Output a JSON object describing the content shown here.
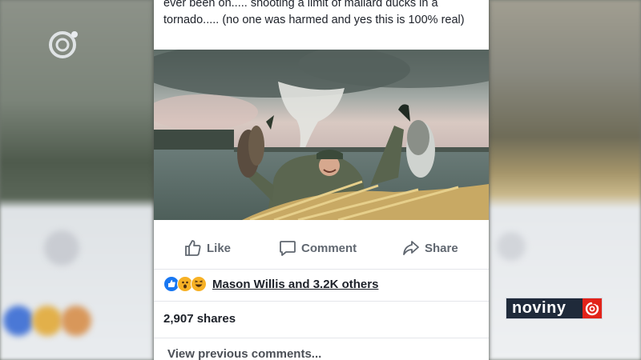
{
  "post": {
    "text": "ever been on..... shooting a limit of mallard ducks in a tornado..... (no one was harmed and yes this is 100% real)"
  },
  "actions": {
    "like_label": "Like",
    "comment_label": "Comment",
    "share_label": "Share"
  },
  "reactions": {
    "icons": [
      "like-icon",
      "wow-icon",
      "haha-icon"
    ],
    "names": "Mason Willis and 3.2K others"
  },
  "stats": {
    "shares": "2,907 shares"
  },
  "comments": {
    "view_previous": "View previous comments..."
  },
  "channel": {
    "name": "noviny",
    "brand_color": "#e2231a"
  },
  "colors": {
    "like_blue": "#1877f2",
    "wow_yellow": "#f7b125",
    "text_dark": "#1d2129",
    "action_gray": "#606770"
  }
}
